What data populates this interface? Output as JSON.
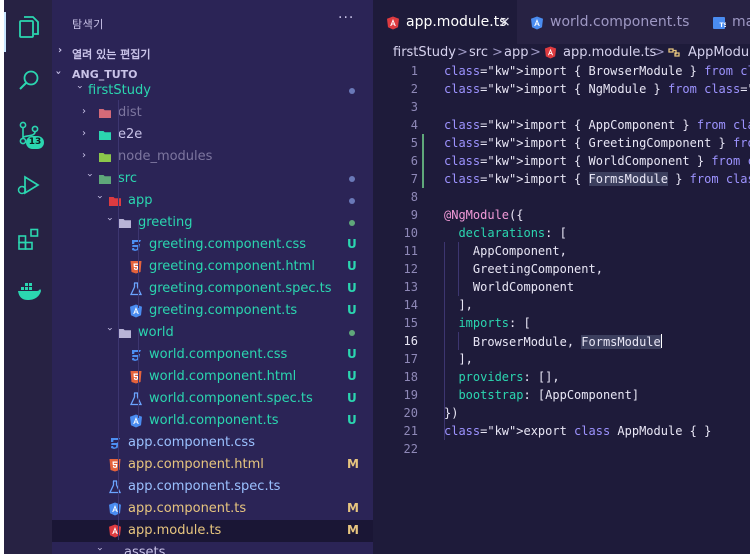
{
  "colors": {
    "untracked": "#2bd6b0",
    "modified": "#e7c57f",
    "accent": "#2bd6b0",
    "folder_teal": "#2bd6b0",
    "angular_red": "#dd3b40",
    "css_blue": "#4d8ff2",
    "html_orange": "#e5633c",
    "spec_blue": "#6ba4ff",
    "ts_blue": "#4a8cf0"
  },
  "activity_bar": {
    "items": [
      {
        "icon": "files-icon"
      },
      {
        "icon": "search-icon"
      },
      {
        "icon": "source-control-icon",
        "badge": "13"
      },
      {
        "icon": "run-debug-icon"
      },
      {
        "icon": "extensions-icon"
      },
      {
        "icon": "docker-icon"
      }
    ]
  },
  "sidebar": {
    "title": "탐색기",
    "more": "···",
    "open_editors": "열려 있는 편집기",
    "workspace": "ANG_TUTO",
    "tree": [
      {
        "name": "firstStudy",
        "type": "folder-open",
        "status": "",
        "dot": true
      },
      {
        "name": "dist",
        "type": "folder-closed",
        "icon": "dist-folder-icon",
        "status": ""
      },
      {
        "name": "e2e",
        "type": "folder-closed",
        "icon": "e2e-folder-icon",
        "status": ""
      },
      {
        "name": "node_modules",
        "type": "folder-closed",
        "icon": "node-modules-icon",
        "status": ""
      },
      {
        "name": "src",
        "type": "folder-open",
        "icon": "src-folder-icon",
        "status": "",
        "dot": true
      },
      {
        "name": "app",
        "type": "folder-open",
        "icon": "app-folder-icon",
        "status": "",
        "dot": true
      },
      {
        "name": "greeting",
        "type": "folder-open",
        "icon": "folder-icon",
        "status": "",
        "dot": true
      },
      {
        "name": "greeting.component.css",
        "type": "css",
        "status": "U"
      },
      {
        "name": "greeting.component.html",
        "type": "html",
        "status": "U"
      },
      {
        "name": "greeting.component.spec.ts",
        "type": "spec",
        "status": "U"
      },
      {
        "name": "greeting.component.ts",
        "type": "ts",
        "status": "U"
      },
      {
        "name": "world",
        "type": "folder-open",
        "icon": "folder-icon",
        "status": "",
        "dot": true
      },
      {
        "name": "world.component.css",
        "type": "css",
        "status": "U"
      },
      {
        "name": "world.component.html",
        "type": "html",
        "status": "U"
      },
      {
        "name": "world.component.spec.ts",
        "type": "spec",
        "status": "U"
      },
      {
        "name": "world.component.ts",
        "type": "ts",
        "status": "U"
      },
      {
        "name": "app.component.css",
        "type": "css",
        "status": ""
      },
      {
        "name": "app.component.html",
        "type": "html",
        "status": "M"
      },
      {
        "name": "app.component.spec.ts",
        "type": "spec",
        "status": ""
      },
      {
        "name": "app.component.ts",
        "type": "ts",
        "status": "M"
      },
      {
        "name": "app.module.ts",
        "type": "angular",
        "status": "M",
        "selected": true
      },
      {
        "name": "assets",
        "type": "folder-open",
        "status": ""
      }
    ]
  },
  "editor": {
    "tabs": [
      {
        "label": "app.module.ts",
        "active": true,
        "close": "×",
        "icon": "angular-icon"
      },
      {
        "label": "world.component.ts",
        "active": false,
        "icon": "angular-component-icon"
      },
      {
        "label": "ma",
        "active": false,
        "icon": "typescript-icon"
      }
    ],
    "breadcrumb": [
      "firstStudy",
      ">",
      "src",
      ">",
      "app",
      ">",
      "app.module.ts",
      ">",
      "AppModule"
    ],
    "lines": [
      {
        "n": "1",
        "t": "import { BrowserModule } from '@angular/pla"
      },
      {
        "n": "2",
        "t": "import { NgModule } from '@angular/core';"
      },
      {
        "n": "3",
        "t": ""
      },
      {
        "n": "4",
        "t": "import { AppComponent } from './app.compone"
      },
      {
        "n": "5",
        "t": "import { GreetingComponent } from './greeti"
      },
      {
        "n": "6",
        "t": "import { WorldComponent } from './world/wor"
      },
      {
        "n": "7",
        "t": "import { FormsModule } from '@angular/forms"
      },
      {
        "n": "8",
        "t": ""
      },
      {
        "n": "9",
        "t": "@NgModule({"
      },
      {
        "n": "10",
        "t": "  declarations: ["
      },
      {
        "n": "11",
        "t": "    AppComponent,"
      },
      {
        "n": "12",
        "t": "    GreetingComponent,"
      },
      {
        "n": "13",
        "t": "    WorldComponent"
      },
      {
        "n": "14",
        "t": "  ],"
      },
      {
        "n": "15",
        "t": "  imports: ["
      },
      {
        "n": "16",
        "t": "    BrowserModule, FormsModule"
      },
      {
        "n": "17",
        "t": "  ],"
      },
      {
        "n": "18",
        "t": "  providers: [],"
      },
      {
        "n": "19",
        "t": "  bootstrap: [AppComponent]"
      },
      {
        "n": "20",
        "t": "})"
      },
      {
        "n": "21",
        "t": "export class AppModule { }"
      },
      {
        "n": "22",
        "t": ""
      }
    ],
    "current_line": "16"
  }
}
